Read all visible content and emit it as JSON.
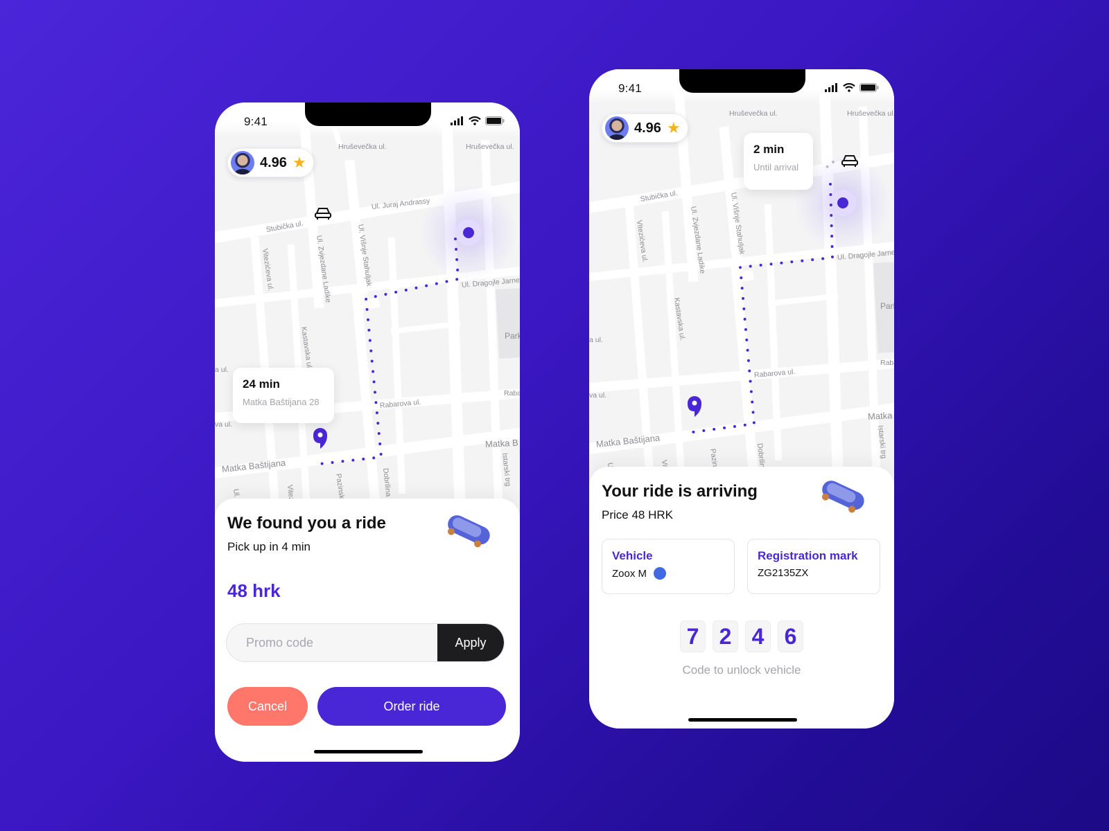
{
  "colors": {
    "accent": "#4a27d6",
    "cancel": "#ff766b",
    "apply": "#1d1d1f",
    "star": "#f6b21b",
    "vehicle_color": "#4169e1",
    "background_start": "#4b25d9",
    "background_end": "#1c0a86"
  },
  "left_phone": {
    "status": {
      "time": "9:41"
    },
    "rating": {
      "value": "4.96",
      "icon": "star-icon"
    },
    "map": {
      "streets": {
        "hrusevecka_1": "Hruševečka ul.",
        "hrusevecka_2": "Hruševečka ul.",
        "juraj_andrassy": "Ul. Juraj Andrassy",
        "stubicka": "Stubička ul.",
        "zvjezdane_ladike": "Ul. Zvjezdane Ladike",
        "visnje_stahuljak": "Ul. Višnje Stahuljak",
        "vitezicева": "Vitezićeva ul.",
        "dragojle": "Ul. Dragojle Jarnević",
        "kastavska": "Kastavska ul.",
        "park": "Park Šo",
        "a_ul": "a ul.",
        "va_ul": "va ul.",
        "rabarova": "Rabarova ul.",
        "raba": "Raba",
        "matka_bastijana": "Matka Baštijana",
        "matka_b": "Matka B",
        "pazinska": "Pazinska",
        "dobrilina": "Dobrilina",
        "istarski_trg": "Istarski trg",
        "ul_v": "Ul. V",
        "vitez": "Vitez"
      },
      "destination_bubble": {
        "time": "24 min",
        "address": "Matka Baštijana 28"
      }
    },
    "sheet": {
      "title": "We found you a ride",
      "subtitle": "Pick up in 4 min",
      "price": "48 hrk",
      "promo_placeholder": "Promo code",
      "promo_value": "",
      "apply_label": "Apply",
      "cancel_label": "Cancel",
      "order_label": "Order ride"
    }
  },
  "right_phone": {
    "status": {
      "time": "9:41"
    },
    "rating": {
      "value": "4.96",
      "icon": "star-icon"
    },
    "map": {
      "streets": {
        "hrusevecka_1": "Hruševečka ul.",
        "hrusevecka_2": "Hruševečka ul.",
        "stubicka": "Stubička ul.",
        "zvjezdane_ladike": "Ul. Zvjezdane Ladike",
        "visnje_stahuljak": "Ul. Višnje Stahuljak",
        "vitezicева": "Vitezićeva ul.",
        "dragojle": "Ul. Dragojle Jarnević",
        "kastavska": "Kastavska ul.",
        "park": "Park Šo",
        "a_ul": "a ul.",
        "va_ul": "va ul.",
        "rabarova": "Rabarova ul.",
        "raba": "Raba",
        "matka_bastijana": "Matka Baštijana",
        "matka_b": "Matka B",
        "pazinska": "Pazinska",
        "dobrilina": "Dobrilina",
        "istarski_trg": "Istarski trg",
        "ul_v": "Ul. V",
        "vitez": "Vitez"
      },
      "arrival_bubble": {
        "time": "2 min",
        "label": "Until arrival"
      }
    },
    "sheet": {
      "title": "Your ride is arriving",
      "subtitle": "Price 48 HRK",
      "vehicle_label": "Vehicle",
      "vehicle_value": "Zoox M",
      "registration_label": "Registration mark",
      "registration_value": "ZG2135ZX",
      "unlock_code": [
        "7",
        "2",
        "4",
        "6"
      ],
      "unlock_caption": "Code to unlock vehicle"
    }
  }
}
